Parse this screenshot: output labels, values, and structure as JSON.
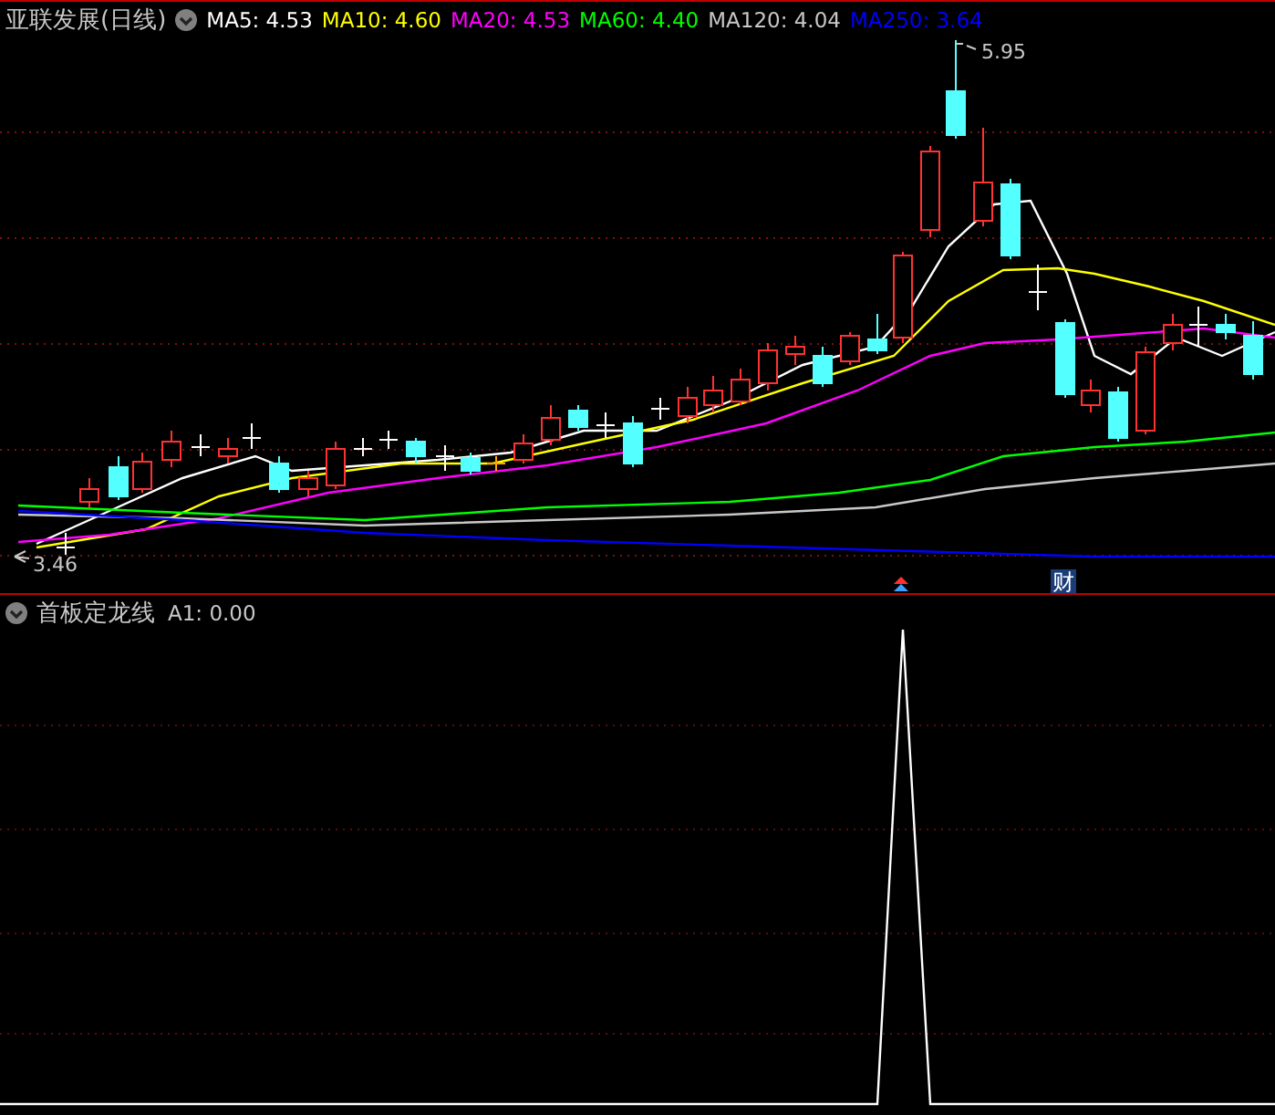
{
  "main_chart": {
    "title": "亚联发展(日线)",
    "indicators": [
      {
        "text": "MA5: 4.53",
        "color": "#ffffff"
      },
      {
        "text": "MA10: 4.60",
        "color": "#ffff00"
      },
      {
        "text": "MA20: 4.53",
        "color": "#ff00ff"
      },
      {
        "text": "MA60: 4.40",
        "color": "#00ff00"
      },
      {
        "text": "MA120: 4.04",
        "color": "#c8c8c8"
      },
      {
        "text": "MA250: 3.64",
        "color": "#0000ff"
      }
    ],
    "high_label": "5.95",
    "low_label": "3.46",
    "badge": "财"
  },
  "sub_chart": {
    "title": "首板定龙线",
    "reading": "A1: 0.00"
  }
}
